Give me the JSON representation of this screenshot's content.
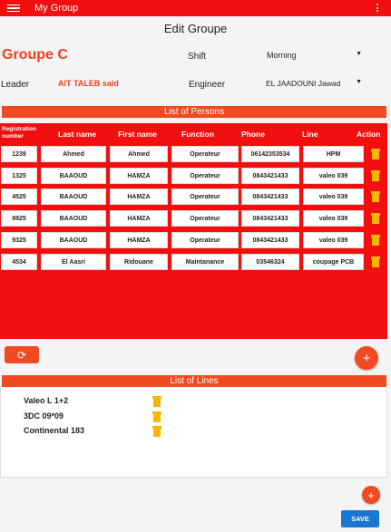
{
  "appbar": {
    "title": "My Group",
    "menu_icon": "menu-icon",
    "more_icon": "more-vertical-icon"
  },
  "page": {
    "title": "Edit Groupe"
  },
  "group": {
    "name": "Groupe C",
    "shift_label": "Shift",
    "shift_value": "Morning",
    "leader_label": "Leader",
    "leader_value": "AIT TALEB said",
    "engineer_label": "Engineer",
    "engineer_value": "EL JAADOUNI Jawad"
  },
  "persons": {
    "section_title": "List of Persons",
    "headers": {
      "registration": [
        "Registration",
        "number"
      ],
      "last_name": "Last name",
      "first_name": "First name",
      "function": "Function",
      "phone": "Phone",
      "line": "Line",
      "action": "Action"
    },
    "rows": [
      {
        "reg": "1239",
        "last": "Ahmed",
        "first": "Ahmed",
        "function": "Operateur",
        "phone": "06142353534",
        "line": "HPM"
      },
      {
        "reg": "1325",
        "last": "BAAOUD",
        "first": "HAMZA",
        "function": "Operateur",
        "phone": "0843421433",
        "line": "valeo 039"
      },
      {
        "reg": "4525",
        "last": "BAAOUD",
        "first": "HAMZA",
        "function": "Operateur",
        "phone": "0843421433",
        "line": "valeo 039"
      },
      {
        "reg": "8925",
        "last": "BAAOUD",
        "first": "HAMZA",
        "function": "Operateur",
        "phone": "0843421433",
        "line": "valeo 039"
      },
      {
        "reg": "9325",
        "last": "BAAOUD",
        "first": "HAMZA",
        "function": "Operateur",
        "phone": "0843421433",
        "line": "valeo 039"
      },
      {
        "reg": "4534",
        "last": "El Aasri",
        "first": "Ridouane",
        "function": "Maintanance",
        "phone": "03546324",
        "line": "coupage PCB"
      }
    ]
  },
  "actions": {
    "refresh_icon": "refresh-icon",
    "add_icon": "plus-icon",
    "refresh_glyph": "⟳",
    "add_glyph": "+"
  },
  "lines": {
    "section_title": "List of Lines",
    "items": [
      "Valeo L 1+2",
      "3DC 09*09",
      "Continental 183"
    ]
  },
  "footer": {
    "save_label": "SAVE"
  },
  "colors": {
    "primary_red": "#f20f0f",
    "accent_orange": "#f04a22",
    "trash_yellow": "#f6b700",
    "save_blue": "#1976d2"
  }
}
